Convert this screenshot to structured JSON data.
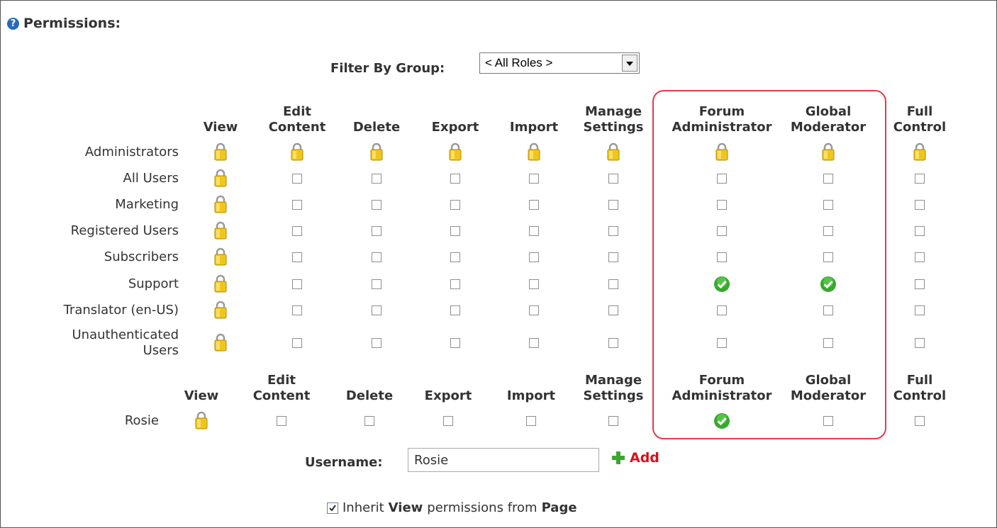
{
  "title": "Permissions:",
  "filter": {
    "label": "Filter By Group:",
    "selected": "< All Roles >"
  },
  "columns": [
    [
      "",
      "View"
    ],
    [
      "Edit",
      "Content"
    ],
    [
      "",
      "Delete"
    ],
    [
      "",
      "Export"
    ],
    [
      "",
      "Import"
    ],
    [
      "Manage",
      "Settings"
    ],
    [
      "Forum",
      "Administrator"
    ],
    [
      "Global",
      "Moderator"
    ],
    [
      "Full",
      "Control"
    ]
  ],
  "roles": [
    {
      "name": [
        "Administrators"
      ],
      "cells": [
        "lock",
        "lock",
        "lock",
        "lock",
        "lock",
        "lock",
        "lock",
        "lock",
        "lock"
      ]
    },
    {
      "name": [
        "All Users"
      ],
      "cells": [
        "lock",
        "box",
        "box",
        "box",
        "box",
        "box",
        "box",
        "box",
        "box"
      ]
    },
    {
      "name": [
        "Marketing"
      ],
      "cells": [
        "lock",
        "box",
        "box",
        "box",
        "box",
        "box",
        "box",
        "box",
        "box"
      ]
    },
    {
      "name": [
        "Registered Users"
      ],
      "cells": [
        "lock",
        "box",
        "box",
        "box",
        "box",
        "box",
        "box",
        "box",
        "box"
      ]
    },
    {
      "name": [
        "Subscribers"
      ],
      "cells": [
        "lock",
        "box",
        "box",
        "box",
        "box",
        "box",
        "box",
        "box",
        "box"
      ]
    },
    {
      "name": [
        "Support"
      ],
      "cells": [
        "lock",
        "box",
        "box",
        "box",
        "box",
        "box",
        "check",
        "check",
        "box"
      ]
    },
    {
      "name": [
        "Translator (en-US)"
      ],
      "cells": [
        "lock",
        "box",
        "box",
        "box",
        "box",
        "box",
        "box",
        "box",
        "box"
      ]
    },
    {
      "name": [
        "Unauthenticated",
        "Users"
      ],
      "cells": [
        "lock",
        "box",
        "box",
        "box",
        "box",
        "box",
        "box",
        "box",
        "box"
      ]
    }
  ],
  "users": [
    {
      "name": [
        "Rosie"
      ],
      "cells": [
        "lock",
        "box",
        "box",
        "box",
        "box",
        "box",
        "check",
        "box",
        "box"
      ]
    }
  ],
  "username": {
    "label": "Username:",
    "value": "Rosie"
  },
  "add_label": "Add",
  "inherit": {
    "prefix": "Inherit",
    "bold1": "View",
    "middle": "permissions from",
    "bold2": "Page"
  },
  "colors": {
    "highlight": "#e23a4c",
    "add": "#d8111b",
    "check": "#3aa72f",
    "lock": "#f0c61c"
  }
}
